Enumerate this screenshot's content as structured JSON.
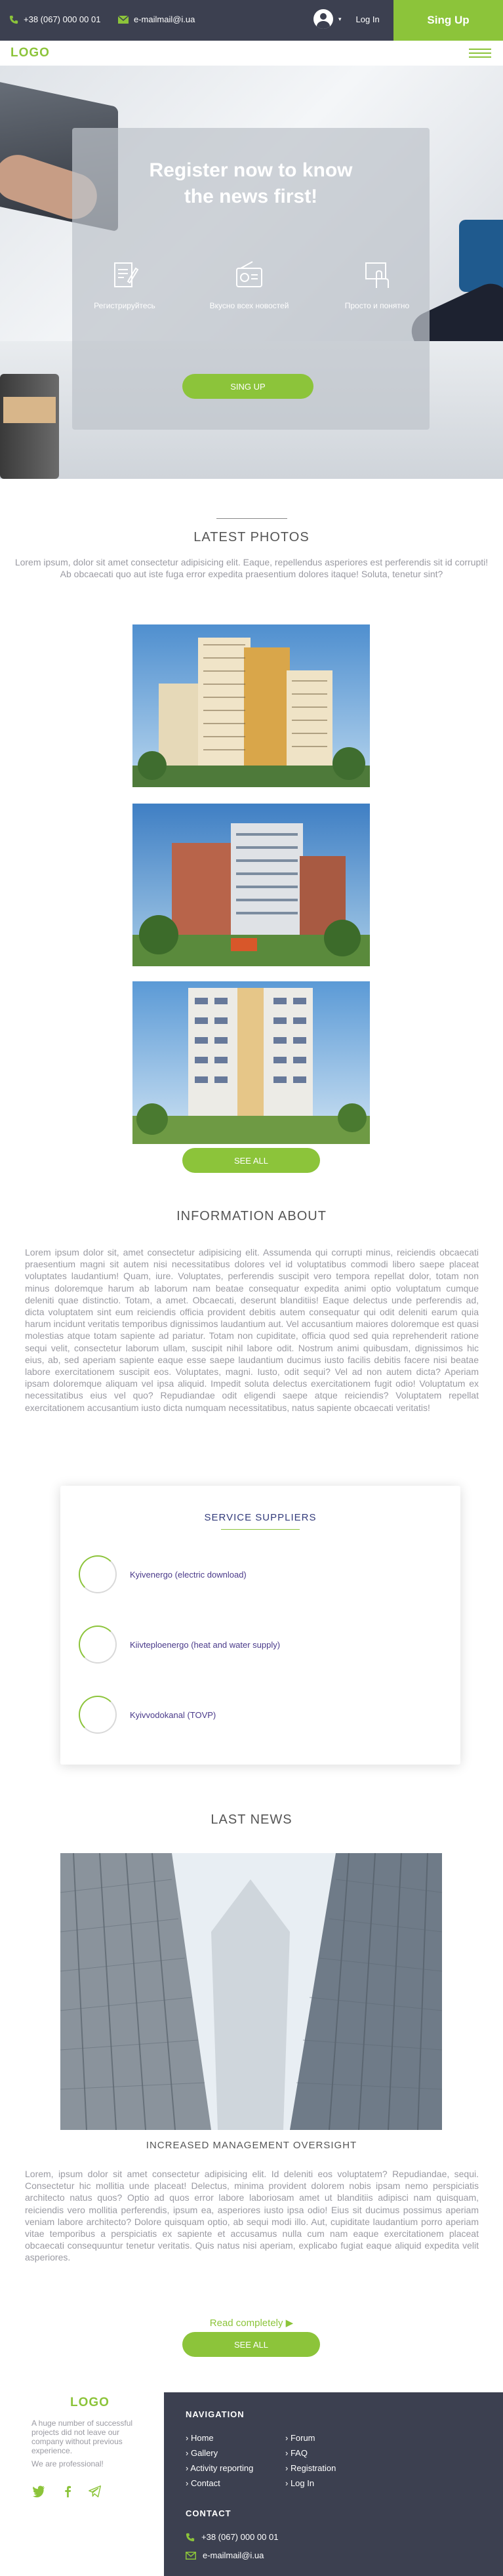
{
  "topbar": {
    "phone": "+38 (067) 000 00 01",
    "email": "e-mailmail@i.ua",
    "login_label": "Log In",
    "signup_label": "Sing Up"
  },
  "header": {
    "logo": "LOGO"
  },
  "hero": {
    "title_line1": "Register now to know",
    "title_line2": "the news first!",
    "features": [
      "Регистрируйтесь",
      "Вкусно всех новостей",
      "Просто и понятно"
    ],
    "button": "SING UP"
  },
  "photos": {
    "title": "LATEST PHOTOS",
    "lead": "Lorem ipsum, dolor sit amet consectetur adipisicing elit. Eaque, repellendus asperiores est perferendis sit id corrupti! Ab obcaecati quo aut iste fuga error expedita praesentium dolores itaque! Soluta, tenetur sint?",
    "button": "SEE ALL"
  },
  "about": {
    "title": "INFORMATION ABOUT",
    "text": "Lorem ipsum dolor sit, amet consectetur adipisicing elit. Assumenda qui corrupti minus, reiciendis obcaecati praesentium magni sit autem nisi necessitatibus dolores vel id voluptatibus commodi libero saepe placeat voluptates laudantium! Quam, iure. Voluptates, perferendis suscipit vero tempora repellat dolor, totam non minus doloremque harum ab laborum nam beatae consequatur expedita animi optio voluptatum cumque deleniti quae distinctio. Totam, a amet. Obcaecati, deserunt blanditiis! Eaque delectus unde perferendis ad, dicta voluptatem sint eum reiciendis officia provident debitis autem consequatur qui odit deleniti earum quia harum incidunt veritatis temporibus dignissimos laudantium aut. Vel accusantium maiores doloremque est quasi molestias atque totam sapiente ad pariatur. Totam non cupiditate, officia quod sed quia reprehenderit ratione sequi velit, consectetur laborum ullam, suscipit nihil labore odit. Nostrum animi quibusdam, dignissimos hic eius, ab, sed aperiam sapiente eaque esse saepe laudantium ducimus iusto facilis debitis facere nisi beatae labore exercitationem suscipit eos. Voluptates, magni. Iusto, odit sequi? Vel ad non autem dicta? Aperiam ipsam doloremque aliquam vel ipsa aliquid. Impedit soluta delectus exercitationem fugit odio! Voluptatum ex necessitatibus eius vel quo? Repudiandae odit eligendi saepe atque reiciendis? Voluptatem repellat exercitationem accusantium iusto dicta numquam necessitatibus, natus sapiente obcaecati veritatis!"
  },
  "suppliers": {
    "title": "SERVICE SUPPLIERS",
    "items": [
      "Kyivenergo (electric download)",
      "Kiivteploenergo (heat and water supply)",
      "Kyivvodokanal (TOVP)"
    ]
  },
  "news": {
    "title": "LAST NEWS",
    "item_title": "INCREASED MANAGEMENT OVERSIGHT",
    "item_text": "Lorem, ipsum dolor sit amet consectetur adipisicing elit. Id deleniti eos voluptatem? Repudiandae, sequi. Consectetur hic mollitia unde placeat! Delectus, minima provident dolorem nobis ipsam nemo perspiciatis architecto natus quos? Optio ad quos error labore laboriosam amet ut blanditiis adipisci nam quisquam, reiciendis vero mollitia perferendis, ipsum ea, asperiores iusto ipsa odio! Eius sit ducimus possimus aperiam veniam labore architecto? Dolore quisquam optio, ab sequi modi illo. Aut, cupiditate laudantium porro aperiam vitae temporibus a perspiciatis ex sapiente et accusamus nulla cum nam eaque exercitationem placeat obcaecati consequuntur tenetur veritatis. Quis natus nisi aperiam, explicabo fugiat eaque aliquid expedita velit asperiores.",
    "read_more": "Read completely",
    "button": "SEE ALL"
  },
  "footer": {
    "logo": "LOGO",
    "tagline": "A huge number of successful projects did not leave our company without previous experience.",
    "professional": "We are professional!",
    "navigation_title": "NAVIGATION",
    "nav_left": [
      "Home",
      "Gallery",
      "Activity reporting",
      "Contact"
    ],
    "nav_right": [
      "Forum",
      "FAQ",
      "Registration",
      "Log In"
    ],
    "contact_title": "CONTACT",
    "phone": "+38 (067) 000 00 01",
    "email": "e-mailmail@i.ua"
  },
  "colors": {
    "accent": "#8cc43a",
    "dark": "#3c4050",
    "supplier_text": "#4a3a8a"
  }
}
